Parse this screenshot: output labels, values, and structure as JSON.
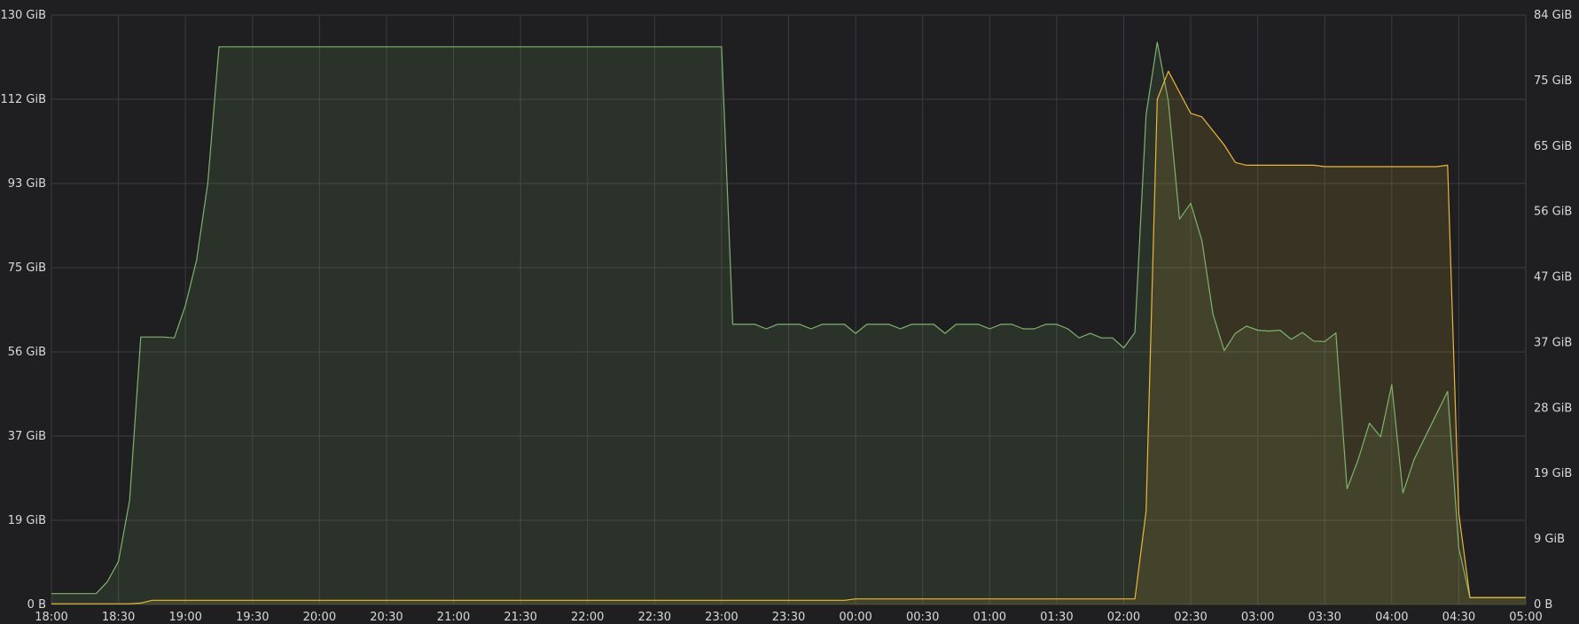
{
  "chart_data": {
    "type": "area",
    "title": "",
    "grid": true,
    "colors": {
      "background": "#1f1f21",
      "grid": "#3b3c40",
      "text": "#d8d9da",
      "green_series": "#7eb26d",
      "yellow_series": "#eab839"
    },
    "x": [
      "18:00",
      "18:10",
      "18:20",
      "18:25",
      "18:30",
      "18:35",
      "18:40",
      "18:45",
      "18:50",
      "18:55",
      "19:00",
      "19:05",
      "19:10",
      "19:15",
      "19:20",
      "23:00",
      "23:05",
      "23:10",
      "23:15",
      "23:20",
      "23:25",
      "23:30",
      "23:35",
      "23:40",
      "23:45",
      "23:50",
      "23:55",
      "00:00",
      "00:05",
      "00:10",
      "00:15",
      "00:20",
      "00:25",
      "00:30",
      "00:35",
      "00:40",
      "00:45",
      "00:50",
      "00:55",
      "01:00",
      "01:05",
      "01:10",
      "01:15",
      "01:20",
      "01:25",
      "01:30",
      "01:35",
      "01:40",
      "01:45",
      "01:50",
      "01:55",
      "02:00",
      "02:05",
      "02:10",
      "02:15",
      "02:20",
      "02:25",
      "02:30",
      "02:35",
      "02:40",
      "02:45",
      "02:50",
      "02:55",
      "03:00",
      "03:05",
      "03:10",
      "03:15",
      "03:20",
      "03:25",
      "03:30",
      "03:35",
      "03:40",
      "03:45",
      "03:50",
      "03:55",
      "04:00",
      "04:05",
      "04:10",
      "04:15",
      "04:20",
      "04:25",
      "04:30",
      "04:35",
      "04:40",
      "04:45",
      "05:00"
    ],
    "x_ticks": [
      "18:00",
      "18:30",
      "19:00",
      "19:30",
      "20:00",
      "20:30",
      "21:00",
      "21:30",
      "22:00",
      "22:30",
      "23:00",
      "23:30",
      "00:00",
      "00:30",
      "01:00",
      "01:30",
      "02:00",
      "02:30",
      "03:00",
      "03:30",
      "04:00",
      "04:30",
      "05:00"
    ],
    "y_left": {
      "label": "",
      "unit": "GiB",
      "ticks": [
        "0 B",
        "19 GiB",
        "37 GiB",
        "56 GiB",
        "75 GiB",
        "93 GiB",
        "112 GiB",
        "130 GiB"
      ],
      "ylim": [
        0,
        130
      ]
    },
    "y_right": {
      "label": "",
      "unit": "GiB",
      "ticks": [
        "0 B",
        "9 GiB",
        "19 GiB",
        "28 GiB",
        "37 GiB",
        "47 GiB",
        "56 GiB",
        "65 GiB",
        "75 GiB",
        "84 GiB"
      ],
      "ylim": [
        0,
        84
      ]
    },
    "series": [
      {
        "axis": "left",
        "color": "#7eb26d",
        "values": [
          2.4,
          2.4,
          2.4,
          5,
          9.5,
          23,
          59,
          59,
          59,
          58.8,
          66,
          76,
          93,
          123,
          123,
          123,
          61.8,
          61.8,
          61.8,
          60.8,
          61.8,
          61.8,
          61.8,
          60.8,
          61.8,
          61.8,
          61.8,
          59.8,
          61.8,
          61.8,
          61.8,
          60.8,
          61.8,
          61.8,
          61.8,
          59.8,
          61.8,
          61.8,
          61.8,
          60.8,
          61.8,
          61.8,
          60.8,
          60.8,
          61.8,
          61.8,
          60.8,
          58.8,
          59.8,
          58.8,
          58.8,
          56.6,
          60,
          108,
          124,
          111,
          85,
          88.5,
          80.3,
          64,
          56,
          59.8,
          61.4,
          60.5,
          60.3,
          60.5,
          58.5,
          60,
          58.1,
          58,
          59.9,
          25.5,
          32,
          40,
          37,
          48.5,
          24.6,
          32,
          37,
          42,
          47,
          12.5,
          1.5,
          1.5,
          1.5,
          1.5
        ]
      },
      {
        "axis": "right",
        "color": "#eab839",
        "values": [
          0.1,
          0.1,
          0.1,
          0.1,
          0.1,
          0.1,
          0.2,
          0.6,
          0.6,
          0.6,
          0.6,
          0.6,
          0.6,
          0.6,
          0.6,
          0.6,
          0.6,
          0.6,
          0.6,
          0.6,
          0.6,
          0.6,
          0.6,
          0.6,
          0.6,
          0.6,
          0.6,
          0.8,
          0.8,
          0.8,
          0.8,
          0.8,
          0.8,
          0.8,
          0.8,
          0.8,
          0.8,
          0.8,
          0.8,
          0.8,
          0.8,
          0.8,
          0.8,
          0.8,
          0.8,
          0.8,
          0.8,
          0.8,
          0.8,
          0.8,
          0.8,
          0.8,
          0.8,
          13.3,
          72,
          76,
          73,
          70,
          69.5,
          67.5,
          65.5,
          63,
          62.6,
          62.6,
          62.6,
          62.6,
          62.6,
          62.6,
          62.6,
          62.4,
          62.4,
          62.4,
          62.4,
          62.4,
          62.4,
          62.4,
          62.4,
          62.4,
          62.4,
          62.4,
          62.6,
          13,
          1,
          1,
          1,
          1
        ]
      }
    ]
  }
}
